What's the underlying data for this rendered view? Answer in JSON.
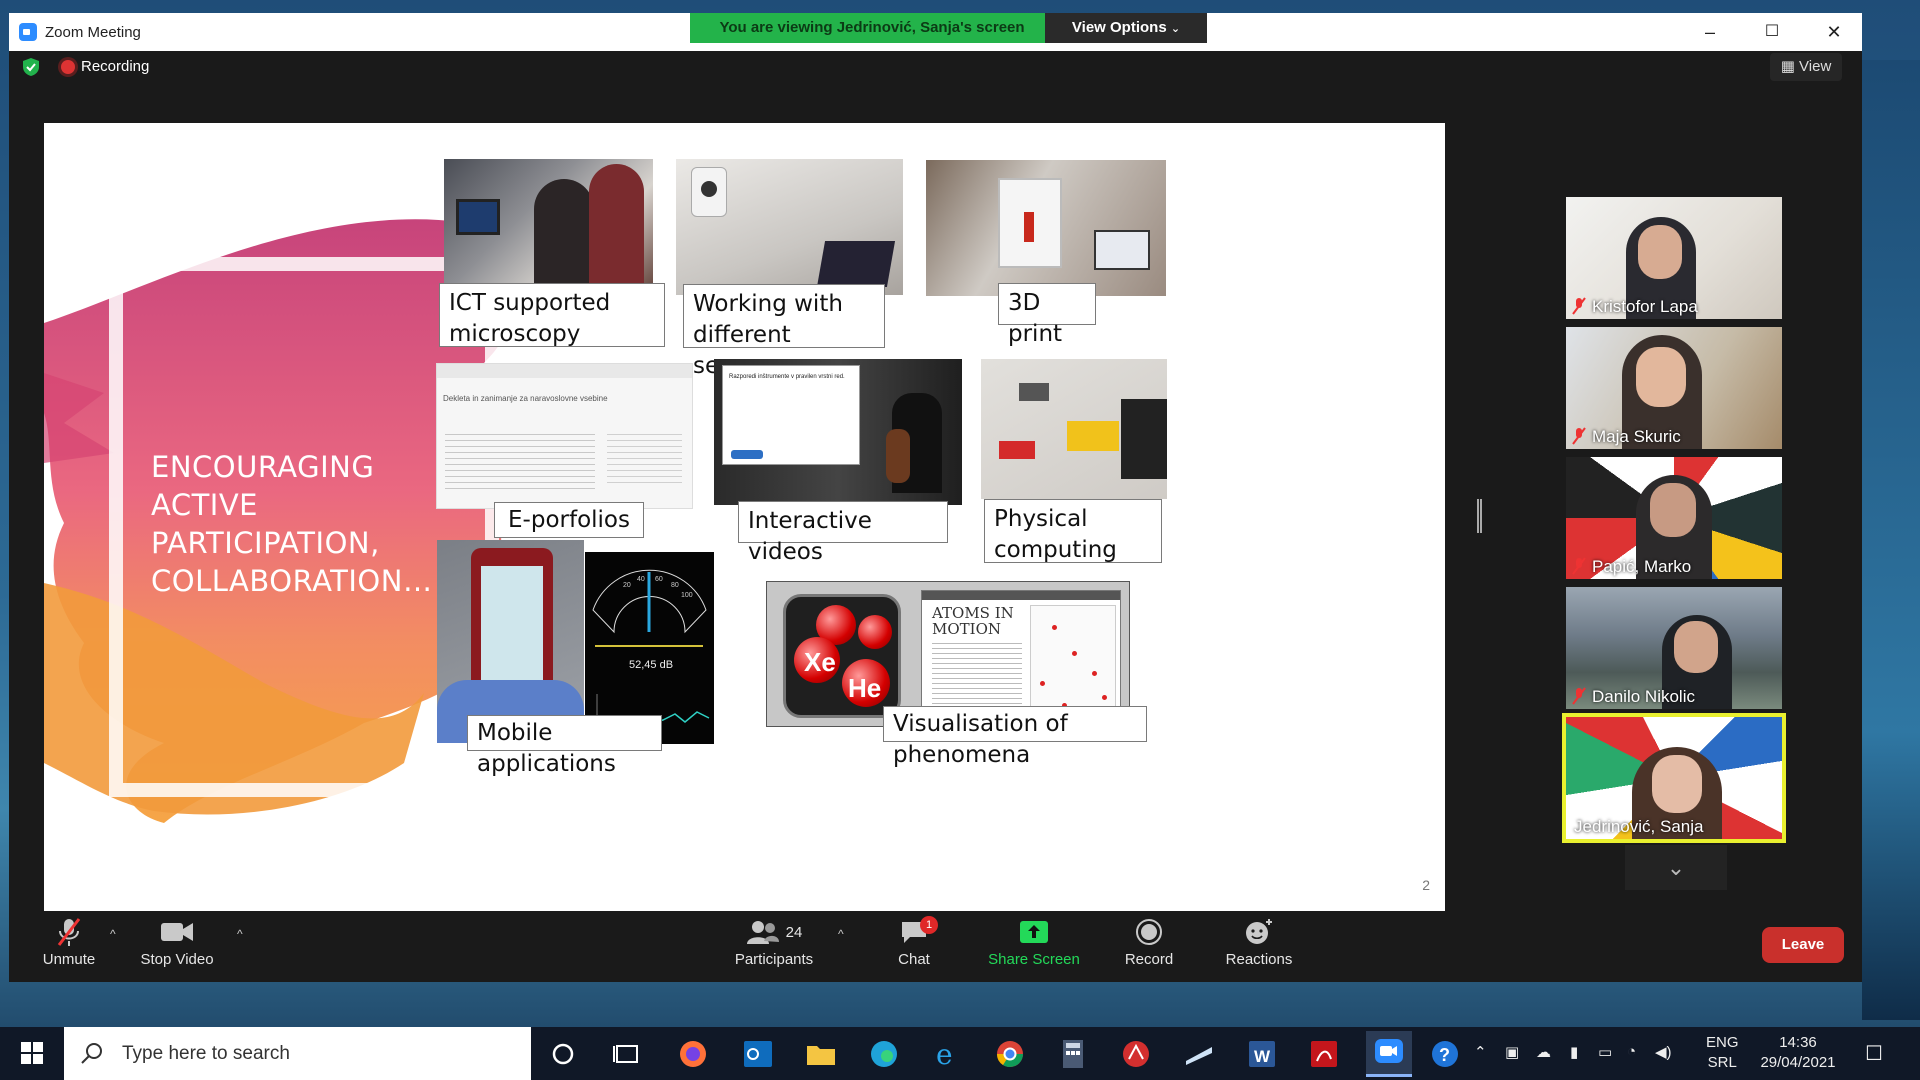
{
  "window": {
    "title": "Zoom Meeting",
    "share_banner": "You are viewing Jedrinović, Sanja's screen",
    "view_options": "View Options",
    "minimize": "–",
    "maximize": "☐",
    "close": "✕"
  },
  "status": {
    "recording": "Recording",
    "view": "View"
  },
  "slide": {
    "heading": "ENCOURAGING ACTIVE PARTICIPATION, COLLABORATION…",
    "captions": {
      "microscopy": "ICT supported microscopy",
      "sensors": "Working with different sensors",
      "print": "3D print",
      "portfolios": "E-porfolios",
      "videos": "Interactive videos",
      "physical": "Physical computing",
      "mobile": "Mobile applications",
      "visualisation": "Visualisation of phenomena"
    },
    "sound_meter": {
      "reading": "52,45 dB",
      "scale": [
        "20",
        "40",
        "60",
        "80",
        "100"
      ]
    },
    "element_labels": {
      "xe": "Xe",
      "he": "He",
      "atoms_title": "ATOMS IN MOTION"
    },
    "portfolio_doc_title": "Dekleta in zanimanje za naravoslovne vsebine",
    "video_question": "Razporedi inštrumente v pravilen vrstni red.",
    "page_number": "2"
  },
  "participants": [
    {
      "name": "Kristofor Lapa",
      "muted": true
    },
    {
      "name": "Maja Skuric",
      "muted": true
    },
    {
      "name": "Papić, Marko",
      "muted": true
    },
    {
      "name": "Danilo Nikolic",
      "muted": true
    },
    {
      "name": "Jedrinović, Sanja",
      "muted": false,
      "active": true
    }
  ],
  "toolbar": {
    "unmute": "Unmute",
    "stop_video": "Stop Video",
    "participants": "Participants",
    "participants_count": "24",
    "chat": "Chat",
    "chat_badge": "1",
    "share_screen": "Share Screen",
    "record": "Record",
    "reactions": "Reactions",
    "leave": "Leave"
  },
  "taskbar": {
    "search_placeholder": "Type here to search",
    "lang_top": "ENG",
    "lang_bottom": "SRL",
    "time": "14:36",
    "date": "29/04/2021"
  },
  "colors": {
    "banner_green": "#23b34a",
    "leave_red": "#c9302c",
    "share_green": "#23d959",
    "active_border": "#e9f02f"
  }
}
